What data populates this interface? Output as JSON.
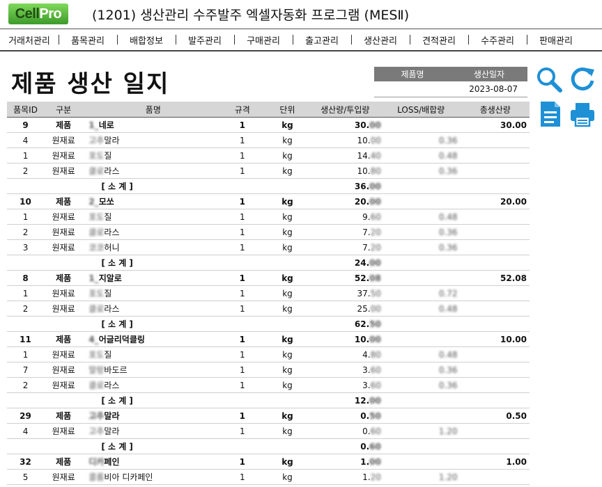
{
  "app": {
    "logo_a": "Cell",
    "logo_b": "Pro",
    "title": "(1201) 생산관리 수주발주 엑셀자동화 프로그램 (MESⅡ)"
  },
  "menu": [
    "거래처관리",
    "품목관리",
    "배합정보",
    "발주관리",
    "구매관리",
    "출고관리",
    "생산관리",
    "견적관리",
    "수주관리",
    "판매관리"
  ],
  "page_title": "제품 생산 일지",
  "info": {
    "product_label": "제품명",
    "date_label": "생산일자",
    "product_value": "",
    "date_value": "2023-08-07"
  },
  "icons": {
    "search": "search-icon",
    "refresh": "refresh-icon",
    "document": "document-icon",
    "print": "printer-icon"
  },
  "columns": [
    "품목ID",
    "구분",
    "품명",
    "규격",
    "단위",
    "생산량/투입량",
    "LOSS/배합량",
    "총생산량"
  ],
  "rows": [
    {
      "kind": "prod",
      "id": "9",
      "type": "제품",
      "name": "1_네로",
      "spec": "1",
      "unit": "kg",
      "qty": "30.00",
      "loss": "",
      "total": "30.00"
    },
    {
      "kind": "mat",
      "id": "4",
      "type": "원재료",
      "name": "고추말라",
      "spec": "1",
      "unit": "kg",
      "qty": "10.00",
      "loss": "0.36",
      "total": ""
    },
    {
      "kind": "mat",
      "id": "1",
      "type": "원재료",
      "name": "포도질",
      "spec": "1",
      "unit": "kg",
      "qty": "14.40",
      "loss": "0.48",
      "total": ""
    },
    {
      "kind": "mat",
      "id": "2",
      "type": "원재료",
      "name": "클로라스",
      "spec": "1",
      "unit": "kg",
      "qty": "10.80",
      "loss": "0.36",
      "total": ""
    },
    {
      "kind": "sub",
      "id": "",
      "type": "",
      "name": "[ 소 계 ]",
      "spec": "",
      "unit": "",
      "qty": "36.00",
      "loss": "",
      "total": ""
    },
    {
      "kind": "prod",
      "id": "10",
      "type": "제품",
      "name": "2_모쏘",
      "spec": "1",
      "unit": "kg",
      "qty": "20.00",
      "loss": "",
      "total": "20.00"
    },
    {
      "kind": "mat",
      "id": "1",
      "type": "원재료",
      "name": "포도질",
      "spec": "1",
      "unit": "kg",
      "qty": "9.60",
      "loss": "0.48",
      "total": ""
    },
    {
      "kind": "mat",
      "id": "2",
      "type": "원재료",
      "name": "클로라스",
      "spec": "1",
      "unit": "kg",
      "qty": "7.20",
      "loss": "0.36",
      "total": ""
    },
    {
      "kind": "mat",
      "id": "3",
      "type": "원재료",
      "name": "코코허니",
      "spec": "1",
      "unit": "kg",
      "qty": "7.20",
      "loss": "0.36",
      "total": ""
    },
    {
      "kind": "sub",
      "id": "",
      "type": "",
      "name": "[ 소 계 ]",
      "spec": "",
      "unit": "",
      "qty": "24.00",
      "loss": "",
      "total": ""
    },
    {
      "kind": "prod",
      "id": "8",
      "type": "제품",
      "name": "1_지알로",
      "spec": "1",
      "unit": "kg",
      "qty": "52.08",
      "loss": "",
      "total": "52.08"
    },
    {
      "kind": "mat",
      "id": "1",
      "type": "원재료",
      "name": "포도질",
      "spec": "1",
      "unit": "kg",
      "qty": "37.50",
      "loss": "0.72",
      "total": ""
    },
    {
      "kind": "mat",
      "id": "2",
      "type": "원재료",
      "name": "클로라스",
      "spec": "1",
      "unit": "kg",
      "qty": "25.00",
      "loss": "0.48",
      "total": ""
    },
    {
      "kind": "sub",
      "id": "",
      "type": "",
      "name": "[ 소 계 ]",
      "spec": "",
      "unit": "",
      "qty": "62.50",
      "loss": "",
      "total": ""
    },
    {
      "kind": "prod",
      "id": "11",
      "type": "제품",
      "name": "4_어글리덕클링",
      "spec": "1",
      "unit": "kg",
      "qty": "10.00",
      "loss": "",
      "total": "10.00"
    },
    {
      "kind": "mat",
      "id": "1",
      "type": "원재료",
      "name": "포도질",
      "spec": "1",
      "unit": "kg",
      "qty": "4.80",
      "loss": "0.48",
      "total": ""
    },
    {
      "kind": "mat",
      "id": "7",
      "type": "원재료",
      "name": "말랑바도르",
      "spec": "1",
      "unit": "kg",
      "qty": "3.60",
      "loss": "0.36",
      "total": ""
    },
    {
      "kind": "mat",
      "id": "2",
      "type": "원재료",
      "name": "클로라스",
      "spec": "1",
      "unit": "kg",
      "qty": "3.60",
      "loss": "0.36",
      "total": ""
    },
    {
      "kind": "sub",
      "id": "",
      "type": "",
      "name": "[ 소 계 ]",
      "spec": "",
      "unit": "",
      "qty": "12.00",
      "loss": "",
      "total": ""
    },
    {
      "kind": "prod",
      "id": "29",
      "type": "제품",
      "name": "고추말라",
      "spec": "1",
      "unit": "kg",
      "qty": "0.50",
      "loss": "",
      "total": "0.50"
    },
    {
      "kind": "mat",
      "id": "4",
      "type": "원재료",
      "name": "고추말라",
      "spec": "1",
      "unit": "kg",
      "qty": "0.60",
      "loss": "1.20",
      "total": ""
    },
    {
      "kind": "sub",
      "id": "",
      "type": "",
      "name": "[ 소 계 ]",
      "spec": "",
      "unit": "",
      "qty": "0.60",
      "loss": "",
      "total": ""
    },
    {
      "kind": "prod",
      "id": "32",
      "type": "제품",
      "name": "디카페인",
      "spec": "1",
      "unit": "kg",
      "qty": "1.00",
      "loss": "",
      "total": "1.00"
    },
    {
      "kind": "mat",
      "id": "5",
      "type": "원재료",
      "name": "콜롬비아 디카페인",
      "spec": "1",
      "unit": "kg",
      "qty": "1.20",
      "loss": "1.20",
      "total": ""
    }
  ]
}
